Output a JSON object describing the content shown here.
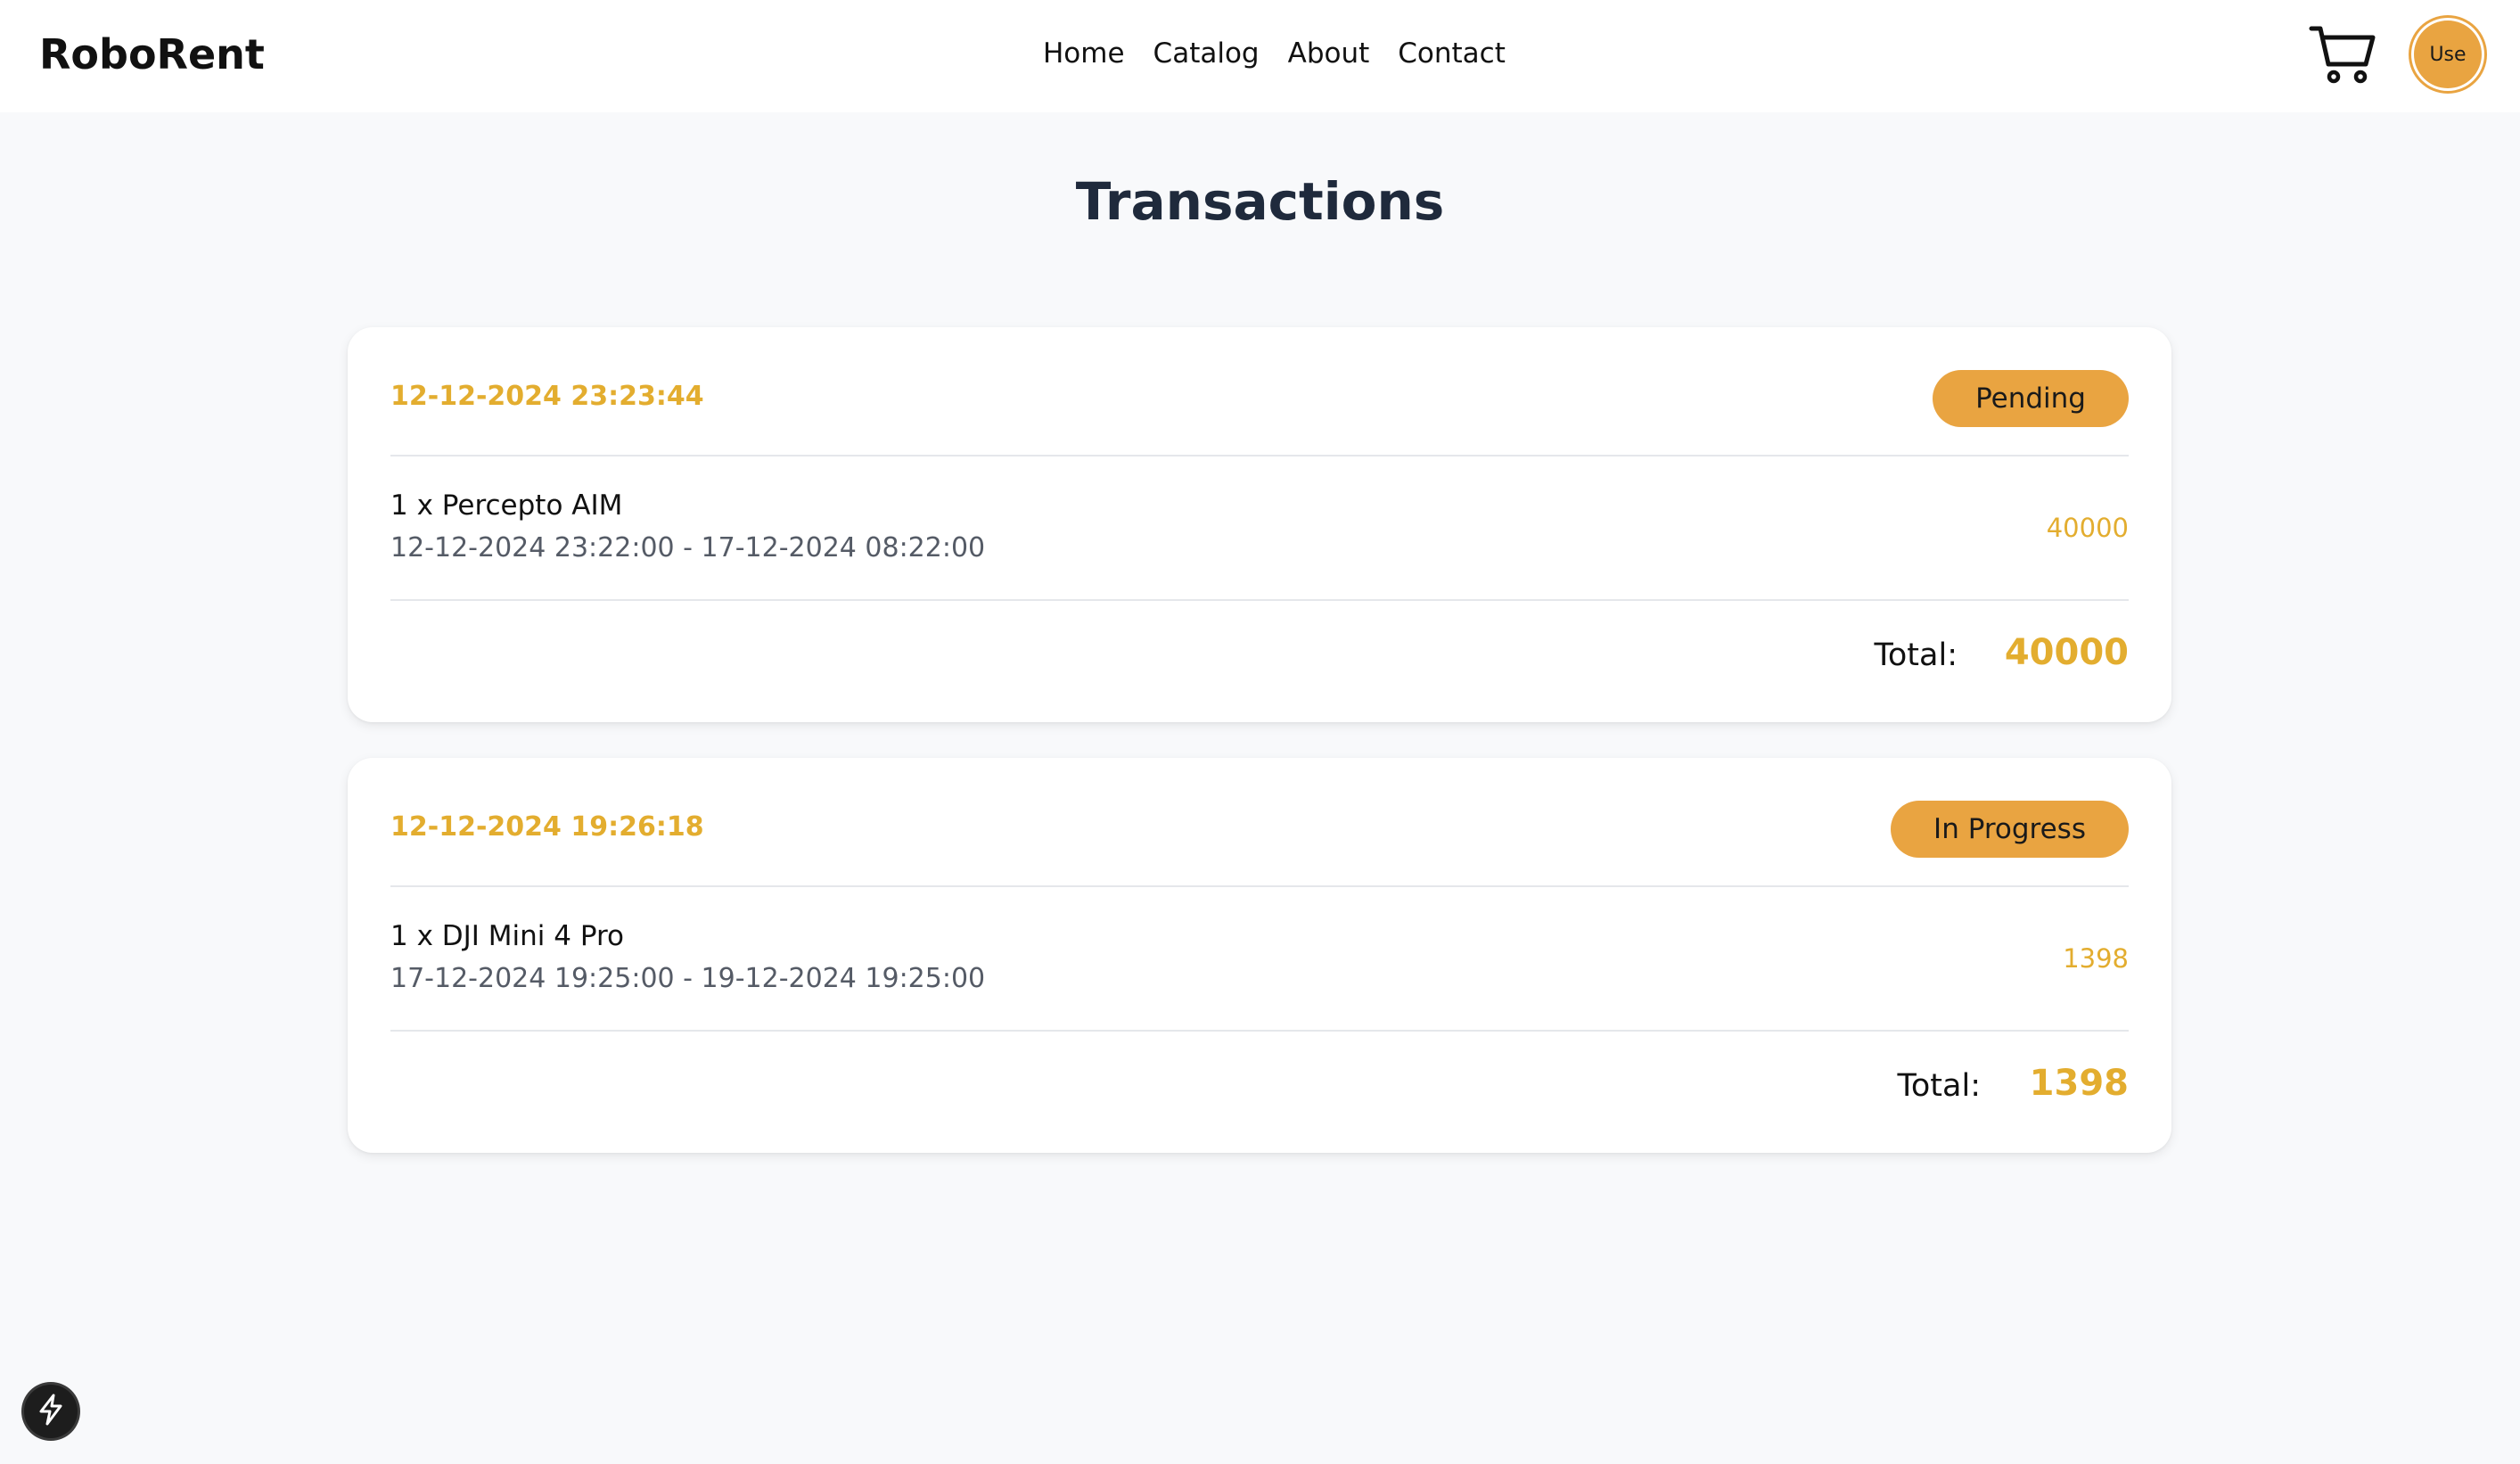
{
  "header": {
    "brand": "RoboRent",
    "nav": [
      "Home",
      "Catalog",
      "About",
      "Contact"
    ],
    "avatar_text": "Use"
  },
  "page": {
    "title": "Transactions"
  },
  "transactions": [
    {
      "date": "12-12-2024 23:23:44",
      "status": "Pending",
      "item": "1 x Percepto AIM",
      "range": "12-12-2024 23:22:00 - 17-12-2024 08:22:00",
      "price": "40000",
      "total_label": "Total:",
      "total": "40000"
    },
    {
      "date": "12-12-2024 19:26:18",
      "status": "In Progress",
      "item": "1 x DJI Mini 4 Pro",
      "range": "17-12-2024 19:25:00 - 19-12-2024 19:25:00",
      "price": "1398",
      "total_label": "Total:",
      "total": "1398"
    }
  ],
  "icons": {
    "cart": "cart-icon",
    "dev": "lightning-icon"
  },
  "colors": {
    "accent": "#e9a441",
    "highlight_text": "#e3ad2f",
    "title": "#1f2a3c"
  }
}
